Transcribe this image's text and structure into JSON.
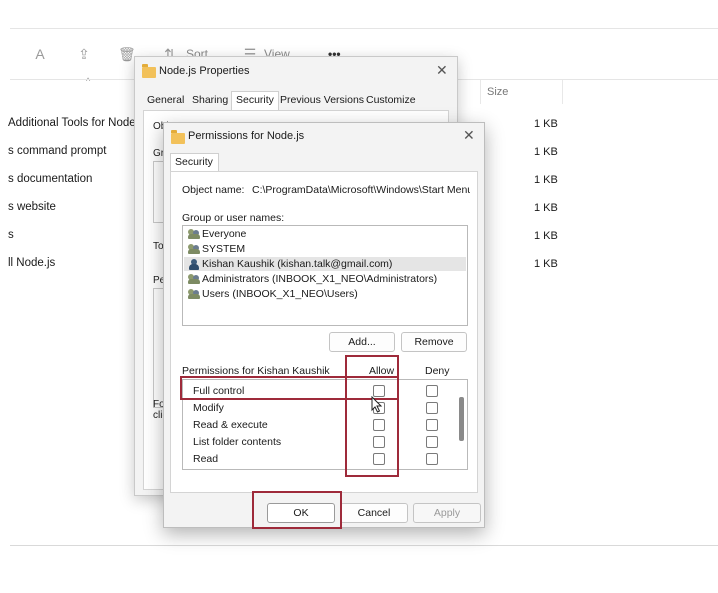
{
  "explorer": {
    "toolbar": {
      "sort_label": "Sort",
      "view_label": "View",
      "more_label": "•••"
    },
    "column_size": "Size",
    "files": [
      {
        "name": "Additional Tools for Node.js",
        "size": "1 KB"
      },
      {
        "name": "s command prompt",
        "size": "1 KB"
      },
      {
        "name": "s documentation",
        "size": "1 KB"
      },
      {
        "name": "s website",
        "size": "1 KB"
      },
      {
        "name": "s",
        "size": "1 KB"
      },
      {
        "name": "ll Node.js",
        "size": "1 KB"
      }
    ]
  },
  "properties": {
    "title": "Node.js Properties",
    "tabs": [
      "General",
      "Sharing",
      "Security",
      "Previous Versions",
      "Customize"
    ],
    "fragments": {
      "object": "Object name:",
      "group": "Gr",
      "to": "To",
      "per": "Pe",
      "fo": "Fo",
      "cli": "clic"
    }
  },
  "permissions": {
    "title": "Permissions for Node.js",
    "tab": "Security",
    "object_name_label": "Object name:",
    "object_name_value": "C:\\ProgramData\\Microsoft\\Windows\\Start Menu\\Pro",
    "group_label": "Group or user names:",
    "users": [
      {
        "name": "Everyone",
        "icon": "group-icon"
      },
      {
        "name": "SYSTEM",
        "icon": "group-icon"
      },
      {
        "name": "Kishan Kaushik (kishan.talk@gmail.com)",
        "icon": "user-icon",
        "selected": true
      },
      {
        "name": "Administrators (INBOOK_X1_NEO\\Administrators)",
        "icon": "group-icon"
      },
      {
        "name": "Users (INBOOK_X1_NEO\\Users)",
        "icon": "group-icon"
      }
    ],
    "add_label": "Add...",
    "remove_label": "Remove",
    "perm_label": "Permissions for Kishan Kaushik",
    "allow_label": "Allow",
    "deny_label": "Deny",
    "rows": [
      {
        "name": "Full control",
        "allow": false,
        "deny": false
      },
      {
        "name": "Modify",
        "allow": false,
        "deny": false
      },
      {
        "name": "Read & execute",
        "allow": false,
        "deny": false
      },
      {
        "name": "List folder contents",
        "allow": false,
        "deny": false
      },
      {
        "name": "Read",
        "allow": false,
        "deny": false
      }
    ],
    "ok_label": "OK",
    "cancel_label": "Cancel",
    "apply_label": "Apply"
  },
  "colors": {
    "highlight": "#9e2a3a",
    "folder": "#f2c15a"
  }
}
